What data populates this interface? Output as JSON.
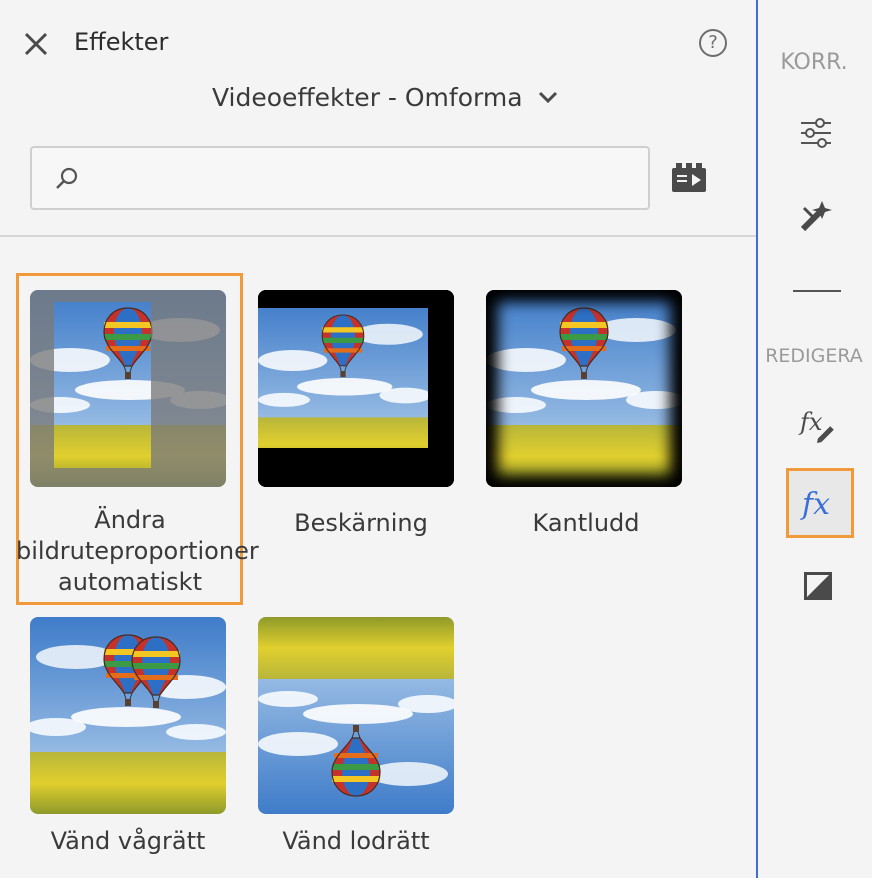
{
  "header": {
    "title": "Effekter",
    "help_label": "?",
    "category": "Videoeffekter - Omforma"
  },
  "search": {
    "placeholder": "",
    "value": ""
  },
  "effects": [
    {
      "label": "Ändra bildruteproportioner automatiskt",
      "selected": true,
      "thumbnail": "auto-reframe"
    },
    {
      "label": "Beskärning",
      "selected": false,
      "thumbnail": "crop"
    },
    {
      "label": "Kantludd",
      "selected": false,
      "thumbnail": "edge-feather"
    },
    {
      "label": "Vänd vågrätt",
      "selected": false,
      "thumbnail": "horizontal-flip"
    },
    {
      "label": "Vänd lodrätt",
      "selected": false,
      "thumbnail": "vertical-flip"
    }
  ],
  "rail": {
    "section_correct": "KORR.",
    "section_edit": "REDIGERA",
    "items": [
      {
        "icon": "sliders-icon",
        "active": false
      },
      {
        "icon": "auto-fix-icon",
        "active": false
      },
      {
        "icon": "fx-edit-icon",
        "active": false
      },
      {
        "icon": "fx-effects-icon",
        "active": true
      },
      {
        "icon": "color-contrast-icon",
        "active": false
      }
    ]
  },
  "colors": {
    "accent": "#3b6fd6",
    "selection": "#f09a3a"
  }
}
